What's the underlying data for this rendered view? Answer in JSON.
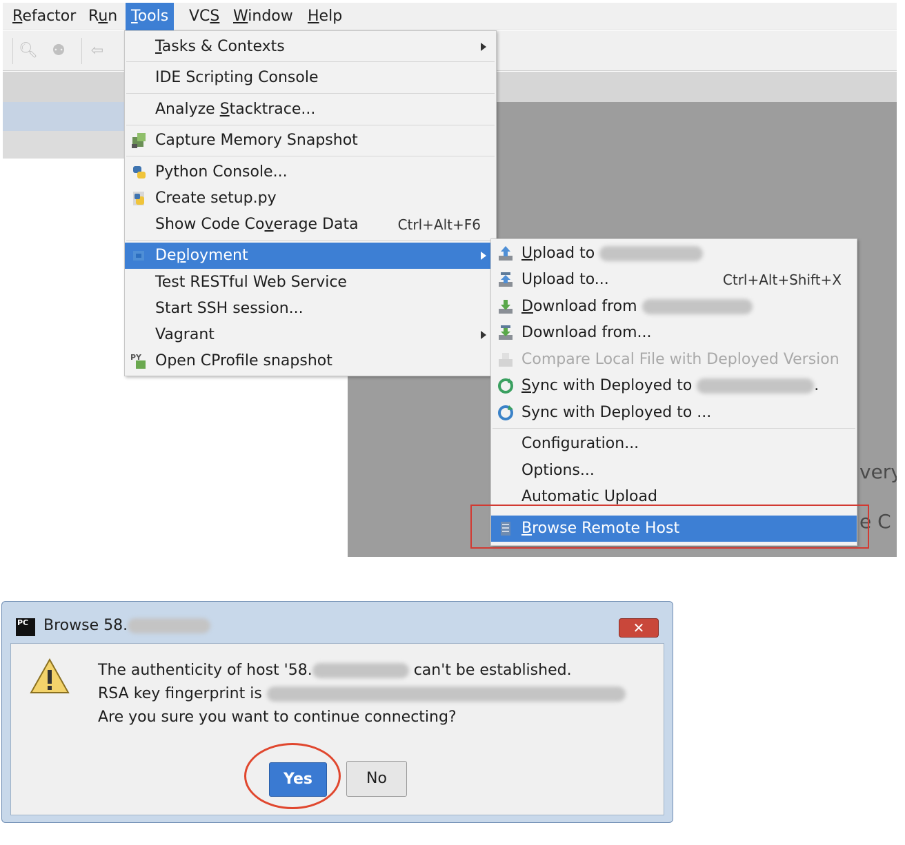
{
  "menubar": {
    "items": [
      "Refactor",
      "Run",
      "Tools",
      "VCS",
      "Window",
      "Help"
    ],
    "active": "Tools"
  },
  "tools_menu": {
    "items": [
      {
        "label": "Tasks & Contexts",
        "submenu": true
      },
      {
        "label": "IDE Scripting Console"
      },
      {
        "label": "Analyze Stacktrace..."
      },
      {
        "label": "Capture Memory Snapshot",
        "icon": "memory-snapshot-icon"
      },
      {
        "label": "Python Console...",
        "icon": "python-icon"
      },
      {
        "label": "Create setup.py",
        "icon": "setup-py-icon"
      },
      {
        "label": "Show Code Coverage Data",
        "shortcut": "Ctrl+Alt+F6"
      },
      {
        "label": "Deployment",
        "submenu": true,
        "highlighted": true,
        "icon": "deployment-icon"
      },
      {
        "label": "Test RESTful Web Service"
      },
      {
        "label": "Start SSH session..."
      },
      {
        "label": "Vagrant",
        "submenu": true
      },
      {
        "label": "Open CProfile snapshot",
        "icon": "cprofile-icon"
      }
    ]
  },
  "deployment_menu": {
    "items": [
      {
        "label": "Upload to",
        "icon": "upload-icon",
        "redacted": true
      },
      {
        "label": "Upload to...",
        "shortcut": "Ctrl+Alt+Shift+X",
        "icon": "upload-to-icon"
      },
      {
        "label": "Download from",
        "icon": "download-icon",
        "redacted": true
      },
      {
        "label": "Download from...",
        "icon": "download-from-icon"
      },
      {
        "label": "Compare Local File with Deployed Version",
        "disabled": true,
        "icon": "compare-icon"
      },
      {
        "label": "Sync with Deployed to",
        "icon": "sync-icon",
        "redacted": true,
        "suffix": "."
      },
      {
        "label": "Sync with Deployed to ...",
        "icon": "sync-icon"
      },
      {
        "label": "Configuration..."
      },
      {
        "label": "Options..."
      },
      {
        "label": "Automatic Upload"
      },
      {
        "label": "Browse Remote Host",
        "highlighted": true,
        "icon": "remote-host-icon"
      }
    ]
  },
  "background": {
    "fragment_1": "very",
    "fragment_2": "e C"
  },
  "dialog": {
    "title": "Browse 58.",
    "app_badge": "PC",
    "close_label": "✕",
    "line_1_start": "The authenticity of host '58.",
    "line_1_end": "can't be established.",
    "line_2": "RSA key fingerprint is",
    "line_3": "Are you sure you want to continue connecting?",
    "yes_label": "Yes",
    "no_label": "No"
  },
  "colors": {
    "highlight": "#3d7fd4",
    "annotation_red": "#d23a32",
    "menu_bg": "#f2f2f2"
  }
}
